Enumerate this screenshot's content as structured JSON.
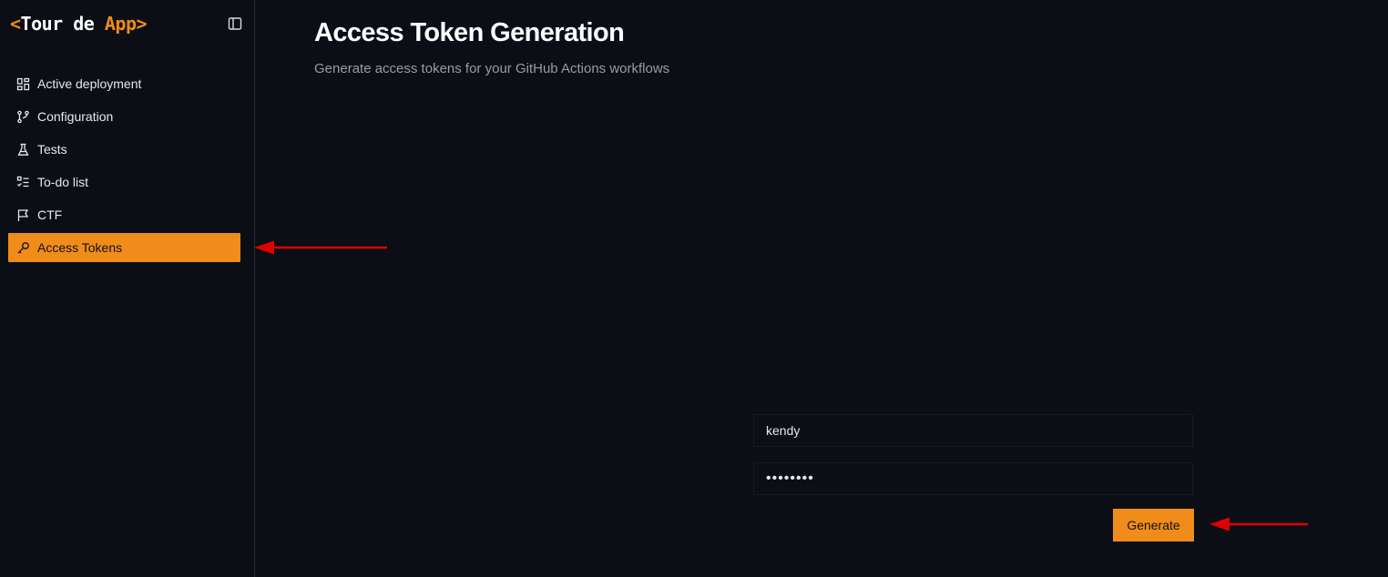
{
  "app": {
    "logo_open": "<",
    "logo_tour": "Tour",
    "logo_de": " de ",
    "logo_app": "App",
    "logo_close": ">"
  },
  "sidebar": {
    "toggle_icon": "sidebar-panel-icon",
    "items": [
      {
        "label": "Active deployment",
        "icon": "dashboard-icon",
        "active": false
      },
      {
        "label": "Configuration",
        "icon": "git-branch-icon",
        "active": false
      },
      {
        "label": "Tests",
        "icon": "flask-icon",
        "active": false
      },
      {
        "label": "To-do list",
        "icon": "checklist-icon",
        "active": false
      },
      {
        "label": "CTF",
        "icon": "flag-icon",
        "active": false
      },
      {
        "label": "Access Tokens",
        "icon": "key-icon",
        "active": true
      }
    ]
  },
  "main": {
    "title": "Access Token Generation",
    "subtitle": "Generate access tokens for your GitHub Actions workflows",
    "username_value": "kendy",
    "password_value": "••••••••",
    "generate_label": "Generate"
  },
  "colors": {
    "background": "#0b0e15",
    "accent": "#f08c1a",
    "annotation_arrow": "#e00000"
  }
}
